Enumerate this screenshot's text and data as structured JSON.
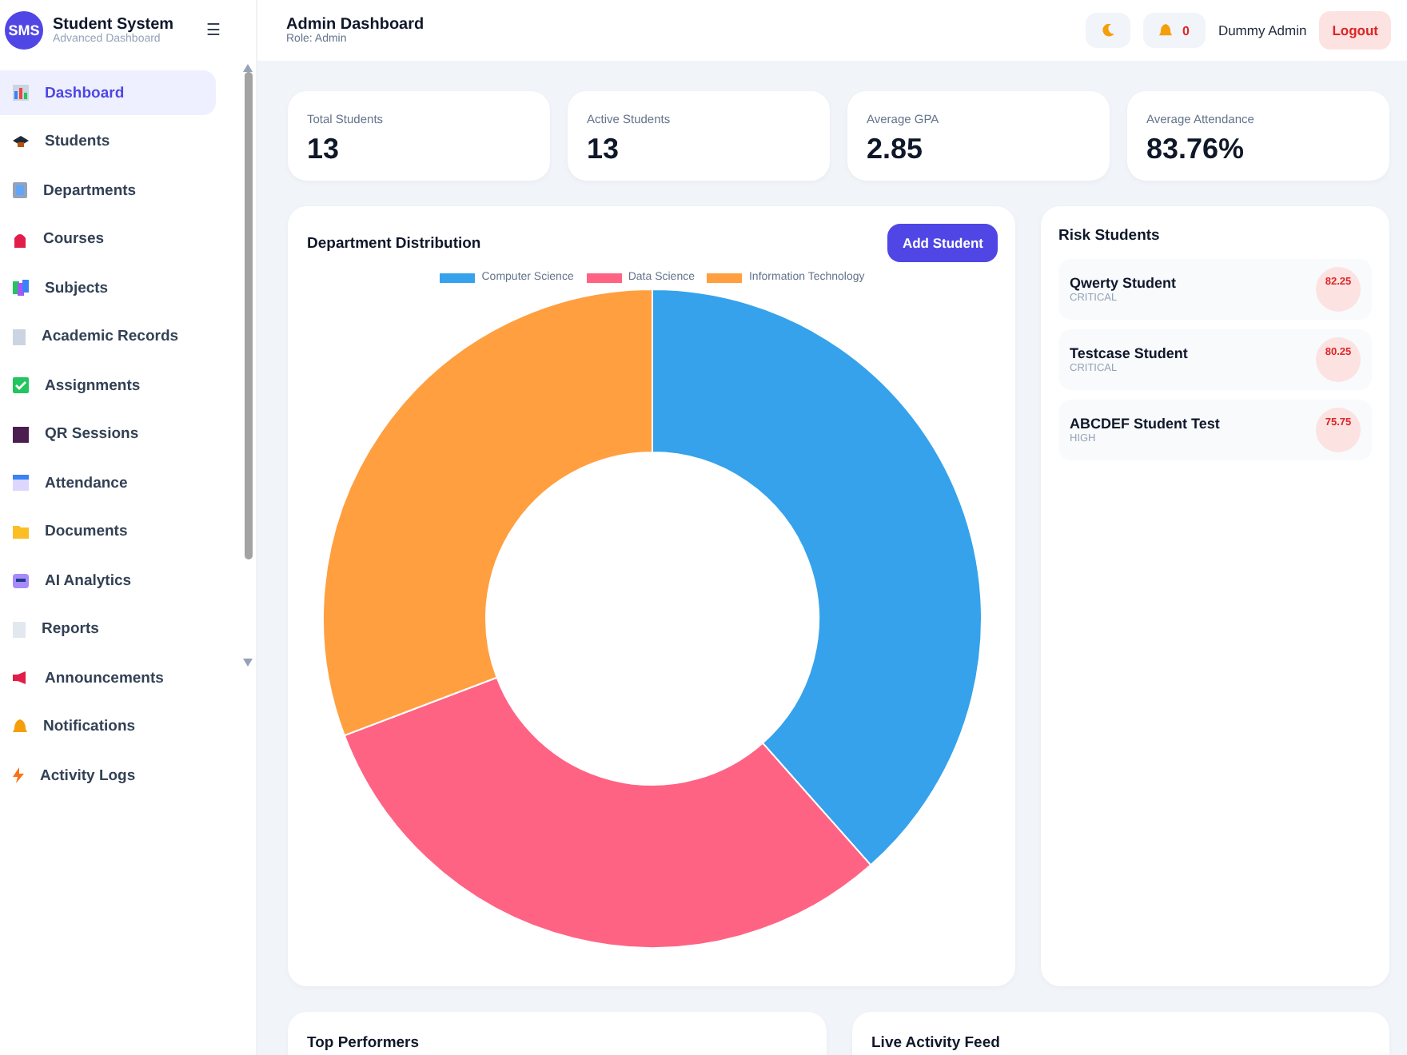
{
  "brand": {
    "logo": "SMS",
    "title": "Student System",
    "subtitle": "Advanced Dashboard",
    "menu_icon": "☰"
  },
  "sidebar": {
    "items": [
      {
        "label": "Dashboard",
        "selected": true
      },
      {
        "label": "Students",
        "selected": false
      },
      {
        "label": "Departments",
        "selected": false
      },
      {
        "label": "Courses",
        "selected": false
      },
      {
        "label": "Subjects",
        "selected": false
      },
      {
        "label": "Academic Records",
        "selected": false
      },
      {
        "label": "Assignments",
        "selected": false
      },
      {
        "label": "QR Sessions",
        "selected": false
      },
      {
        "label": "Attendance",
        "selected": false
      },
      {
        "label": "Documents",
        "selected": false
      },
      {
        "label": "AI Analytics",
        "selected": false
      },
      {
        "label": "Reports",
        "selected": false
      },
      {
        "label": "Announcements",
        "selected": false
      },
      {
        "label": "Notifications",
        "selected": false
      },
      {
        "label": "Activity Logs",
        "selected": false
      }
    ]
  },
  "header": {
    "title": "Admin Dashboard",
    "role": "Role: Admin",
    "notification_count": "0",
    "user": "Dummy Admin",
    "logout": "Logout"
  },
  "stats": [
    {
      "label": "Total Students",
      "value": "13"
    },
    {
      "label": "Active Students",
      "value": "13"
    },
    {
      "label": "Average GPA",
      "value": "2.85"
    },
    {
      "label": "Average Attendance",
      "value": "83.76%"
    }
  ],
  "distribution": {
    "title": "Department Distribution",
    "button": "Add Student",
    "chart_data": {
      "type": "donut",
      "legend": "top",
      "categories": [
        "Computer Science",
        "Data Science",
        "Information Technology"
      ],
      "series": [
        {
          "colors": [
            "#36a2eb",
            "#ff6384",
            "#ff9f40"
          ],
          "values": [
            38.46,
            30.77,
            30.77
          ]
        }
      ]
    }
  },
  "risk": {
    "title": "Risk Students",
    "items": [
      {
        "name": "Qwerty Student",
        "level": "CRITICAL",
        "score": "82.25"
      },
      {
        "name": "Testcase Student",
        "level": "CRITICAL",
        "score": "80.25"
      },
      {
        "name": "ABCDEF Student Test",
        "level": "HIGH",
        "score": "75.75"
      }
    ]
  },
  "bottom_panels": [
    {
      "title": "Top Performers"
    },
    {
      "title": "Live Activity Feed"
    }
  ]
}
